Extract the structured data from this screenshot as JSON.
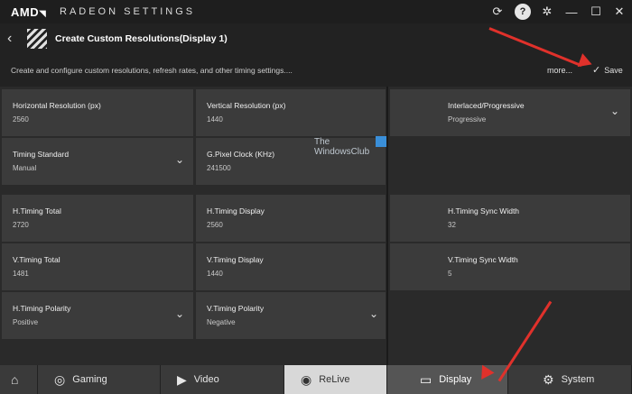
{
  "titlebar": {
    "logo": "AMD",
    "title": "RADEON SETTINGS",
    "icons": [
      "update-icon",
      "help-icon",
      "gear-icon",
      "minimize-icon",
      "maximize-icon",
      "close-icon"
    ],
    "help_label": "?"
  },
  "header": {
    "title": "Create Custom Resolutions(Display 1)"
  },
  "subbar": {
    "subtitle": "Create and configure custom resolutions, refresh rates, and other timing settings....",
    "more": "more...",
    "save": "Save"
  },
  "fields": {
    "horizontal_resolution": {
      "label": "Horizontal Resolution (px)",
      "value": "2560"
    },
    "vertical_resolution": {
      "label": "Vertical Resolution (px)",
      "value": "1440"
    },
    "interlaced": {
      "label": "Interlaced/Progressive",
      "value": "Progressive"
    },
    "timing_standard": {
      "label": "Timing Standard",
      "value": "Manual"
    },
    "pixel_clock": {
      "label": "G.Pixel Clock (KHz)",
      "value": "241500"
    },
    "h_timing_total": {
      "label": "H.Timing Total",
      "value": "2720"
    },
    "h_timing_display": {
      "label": "H.Timing Display",
      "value": "2560"
    },
    "h_timing_sync_width": {
      "label": "H.Timing Sync Width",
      "value": "32"
    },
    "v_timing_total": {
      "label": "V.Timing Total",
      "value": "1481"
    },
    "v_timing_display": {
      "label": "V.Timing Display",
      "value": "1440"
    },
    "v_timing_sync_width": {
      "label": "V.Timing Sync Width",
      "value": "5"
    },
    "h_timing_polarity": {
      "label": "H.Timing Polarity",
      "value": "Positive"
    },
    "v_timing_polarity": {
      "label": "V.Timing Polarity",
      "value": "Negative"
    }
  },
  "watermark": {
    "line1": "The",
    "line2": "WindowsClub"
  },
  "tabs": [
    {
      "label": "",
      "icon": "home-icon"
    },
    {
      "label": "Gaming",
      "icon": "gamepad-icon"
    },
    {
      "label": "Video",
      "icon": "play-icon"
    },
    {
      "label": "ReLive",
      "icon": "relive-icon"
    },
    {
      "label": "Display",
      "icon": "monitor-icon"
    },
    {
      "label": "System",
      "icon": "system-icon"
    }
  ],
  "colors": {
    "accent": "#e0312b",
    "panel": "#3b3b3b",
    "background": "#2a2a2a"
  }
}
